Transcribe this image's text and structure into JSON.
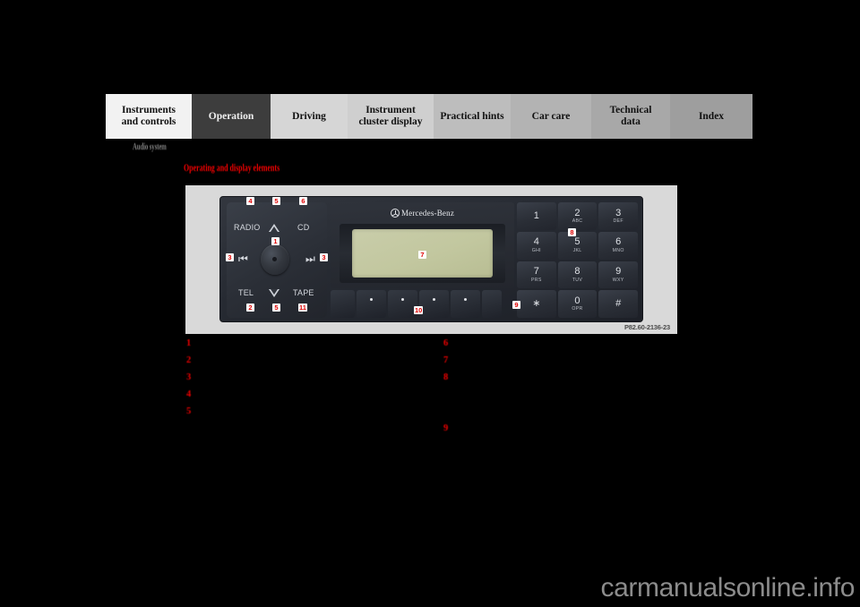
{
  "nav": {
    "tabs": [
      {
        "label": "Instruments and controls",
        "line1": "Instruments",
        "line2": "and controls",
        "key": "instruments",
        "active": false
      },
      {
        "label": "Operation",
        "line1": "Operation",
        "line2": "",
        "key": "operation",
        "active": true
      },
      {
        "label": "Driving",
        "line1": "Driving",
        "line2": "",
        "key": "driving",
        "active": false
      },
      {
        "label": "Instrument cluster display",
        "line1": "Instrument",
        "line2": "cluster display",
        "key": "cluster",
        "active": false
      },
      {
        "label": "Practical hints",
        "line1": "Practical hints",
        "line2": "",
        "key": "hints",
        "active": false
      },
      {
        "label": "Car care",
        "line1": "Car care",
        "line2": "",
        "key": "carcare",
        "active": false
      },
      {
        "label": "Technical data",
        "line1": "Technical",
        "line2": "data",
        "key": "technical",
        "active": false
      },
      {
        "label": "Index",
        "line1": "Index",
        "line2": "",
        "key": "index",
        "active": false
      }
    ]
  },
  "headings": {
    "section": "Audio system",
    "subsection": "Operating and display elements"
  },
  "figure": {
    "caption": "P82.60-2136-23",
    "brand": "Mercedes-Benz",
    "controls": {
      "radio": "RADIO",
      "cd": "CD",
      "tel": "TEL",
      "tape": "TAPE",
      "seek_prev": "⏮",
      "seek_next": "⏭"
    },
    "keypad": [
      {
        "digit": "1",
        "sub": ""
      },
      {
        "digit": "2",
        "sub": "ABC"
      },
      {
        "digit": "3",
        "sub": "DEF"
      },
      {
        "digit": "4",
        "sub": "GHI"
      },
      {
        "digit": "5",
        "sub": "JKL"
      },
      {
        "digit": "6",
        "sub": "MNO"
      },
      {
        "digit": "7",
        "sub": "PRS"
      },
      {
        "digit": "8",
        "sub": "TUV"
      },
      {
        "digit": "9",
        "sub": "WXY"
      },
      {
        "digit": "∗",
        "sub": ""
      },
      {
        "digit": "0",
        "sub": "OPR"
      },
      {
        "digit": "#",
        "sub": ""
      }
    ],
    "callouts": {
      "c1": "1",
      "c2": "2",
      "c3a": "3",
      "c3b": "3",
      "c4": "4",
      "c5a": "5",
      "c5b": "5",
      "c6": "6",
      "c7": "7",
      "c8": "8",
      "c9": "9",
      "c10": "10",
      "c11": "11"
    }
  },
  "legend": {
    "left": [
      {
        "num": "1",
        "text": ""
      },
      {
        "num": "2",
        "text": ""
      },
      {
        "num": "3",
        "text": ""
      },
      {
        "num": "4",
        "text": ""
      },
      {
        "num": "5",
        "text": ""
      }
    ],
    "right": [
      {
        "num": "6",
        "text": ""
      },
      {
        "num": "7",
        "text": ""
      },
      {
        "num": "8",
        "text": ""
      },
      {
        "num": "9",
        "text": ""
      }
    ]
  },
  "watermark": "carmanualsonline.info",
  "colors": {
    "accent_red": "#ee0000",
    "active_tab_bg": "#3d3d3d",
    "lcd": "#c2c79f",
    "page_bg": "#000000",
    "figure_bg": "#d9d9d9"
  }
}
